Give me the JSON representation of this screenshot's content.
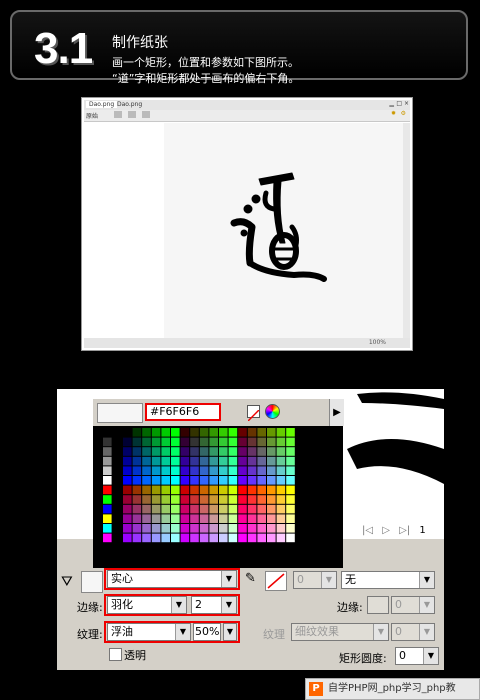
{
  "banner": {
    "number": "3.1",
    "title": "制作纸张",
    "line1": "画一个矩形，位置和参数如下图所示。",
    "line2": "“道”字和矩形都处于画布的偏右下角。"
  },
  "shot1": {
    "tab1": "Dao.png",
    "tab2": "Dao.png",
    "toolbar_label": "原始",
    "status_text": "",
    "zoom": "100%"
  },
  "popup": {
    "hex": "#F6F6F6"
  },
  "props": {
    "fill_type": "实心",
    "edge_label": "边缘:",
    "edge_value": "羽化",
    "edge_amount": "2",
    "texture_label": "纹理:",
    "texture_value": "浮油",
    "texture_amount": "50%",
    "transparent_label": "透明",
    "stroke_type": "无",
    "stroke_num": "0",
    "right_edge_label": "边缘:",
    "right_edge_value": "0",
    "right_texture_label": "纹理",
    "right_texture_value": "细纹效果",
    "right_texture_amount": "0",
    "corner_label": "矩形圆度:",
    "corner_value": "0"
  },
  "pager": {
    "page": "1"
  },
  "watermark": {
    "text": "自学PHP网_php学习_php教"
  },
  "colors": {
    "highlight": "#ee0000",
    "panel": "#d4d0c8",
    "canvas": "#f6f6f6"
  }
}
